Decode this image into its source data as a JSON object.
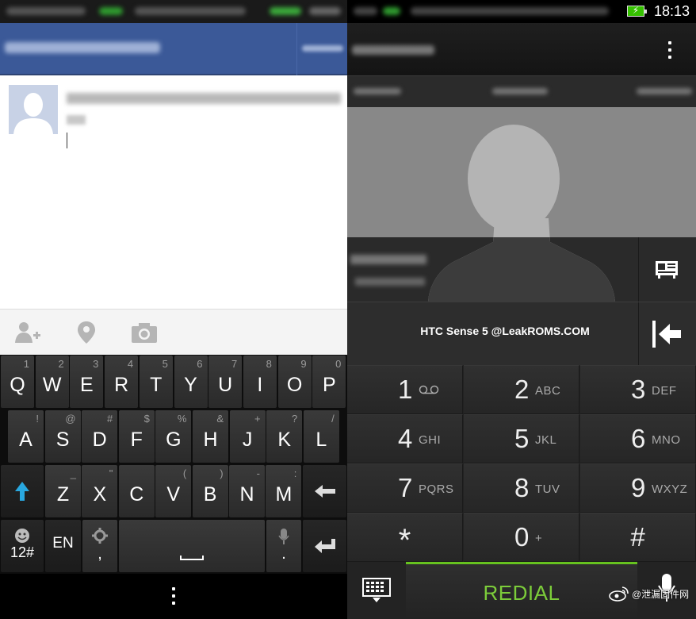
{
  "left": {
    "keyboard": {
      "row1": [
        {
          "k": "Q",
          "s": "1"
        },
        {
          "k": "W",
          "s": "2"
        },
        {
          "k": "E",
          "s": "3"
        },
        {
          "k": "R",
          "s": "4"
        },
        {
          "k": "T",
          "s": "5"
        },
        {
          "k": "Y",
          "s": "6"
        },
        {
          "k": "U",
          "s": "7"
        },
        {
          "k": "I",
          "s": "8"
        },
        {
          "k": "O",
          "s": "9"
        },
        {
          "k": "P",
          "s": "0"
        }
      ],
      "row2": [
        {
          "k": "A",
          "s": "!"
        },
        {
          "k": "S",
          "s": "@"
        },
        {
          "k": "D",
          "s": "#"
        },
        {
          "k": "F",
          "s": "$"
        },
        {
          "k": "G",
          "s": "%"
        },
        {
          "k": "H",
          "s": "&"
        },
        {
          "k": "J",
          "s": "+"
        },
        {
          "k": "K",
          "s": "?"
        },
        {
          "k": "L",
          "s": "/"
        }
      ],
      "row3": [
        {
          "k": "Z",
          "s": "_"
        },
        {
          "k": "X",
          "s": "\""
        },
        {
          "k": "C",
          "s": ""
        },
        {
          "k": "V",
          "s": "("
        },
        {
          "k": "B",
          "s": ")"
        },
        {
          "k": "N",
          "s": "-"
        },
        {
          "k": "M",
          "s": ":"
        }
      ],
      "symbols_key": "12#",
      "language_key": "EN",
      "settings_key_sub": ",",
      "mic_key_sub": "."
    },
    "accent_color": "#3b5998"
  },
  "right": {
    "status": {
      "time": "18:13"
    },
    "number_display": "HTC Sense 5 @LeakROMS.COM",
    "dialpad": [
      {
        "d": "1",
        "l": ""
      },
      {
        "d": "2",
        "l": "ABC"
      },
      {
        "d": "3",
        "l": "DEF"
      },
      {
        "d": "4",
        "l": "GHI"
      },
      {
        "d": "5",
        "l": "JKL"
      },
      {
        "d": "6",
        "l": "MNO"
      },
      {
        "d": "7",
        "l": "PQRS"
      },
      {
        "d": "8",
        "l": "TUV"
      },
      {
        "d": "9",
        "l": "WXYZ"
      },
      {
        "d": "*",
        "l": ""
      },
      {
        "d": "0",
        "l": "+"
      },
      {
        "d": "#",
        "l": ""
      }
    ],
    "redial_label": "REDIAL",
    "accent_color": "#66c21f",
    "watermark": "@泄漏固件网"
  }
}
